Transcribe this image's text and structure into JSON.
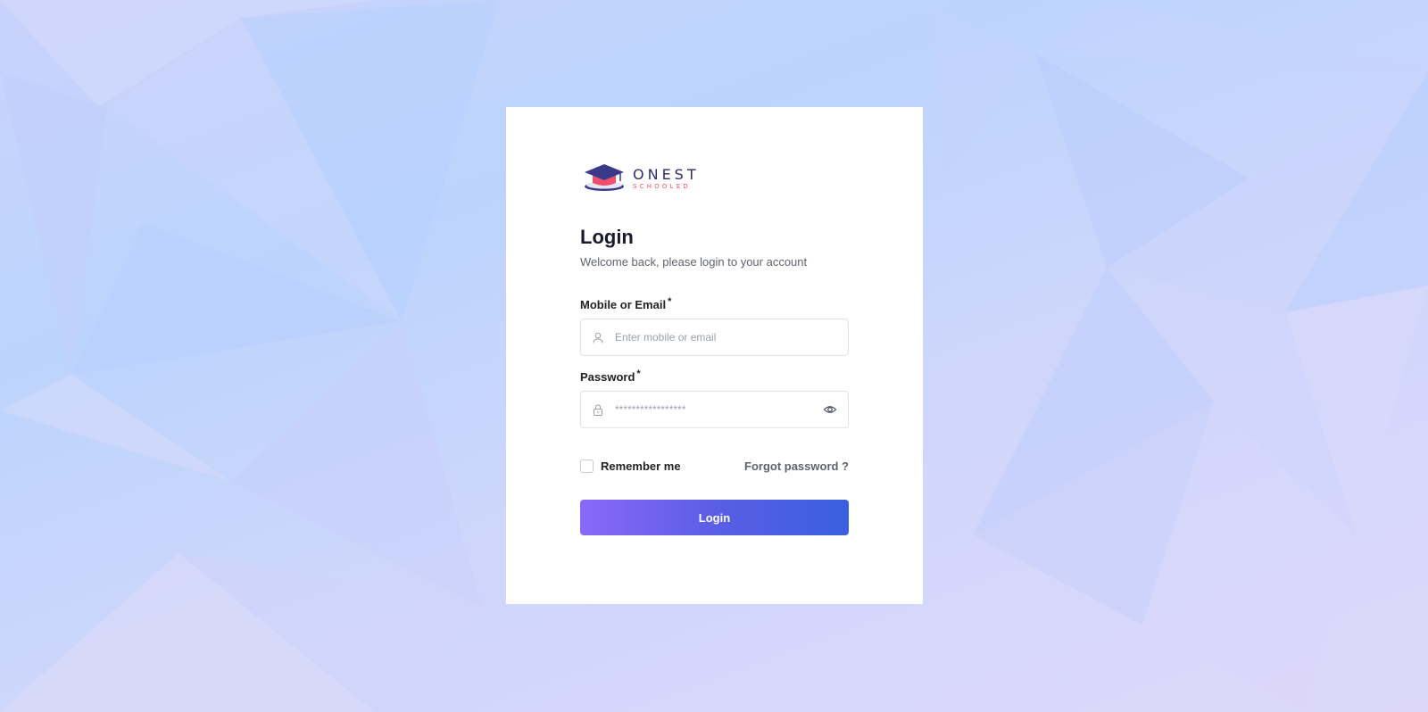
{
  "brand": {
    "name": "ONEST",
    "tagline": "SCHOOLED",
    "primary_color": "#2e2a6e",
    "accent_color": "#f0506e"
  },
  "login": {
    "title": "Login",
    "subtitle": "Welcome back, please login to your account",
    "email_label": "Mobile or Email",
    "email_placeholder": "Enter mobile or email",
    "email_value": "",
    "password_label": "Password",
    "password_placeholder": "*****************",
    "password_value": "",
    "required_marker": "*",
    "remember_label": "Remember me",
    "remember_checked": false,
    "forgot_label": "Forgot password ?",
    "submit_label": "Login"
  },
  "icons": {
    "email": "user-icon",
    "password": "lock-icon",
    "toggle_password": "eye-icon"
  }
}
